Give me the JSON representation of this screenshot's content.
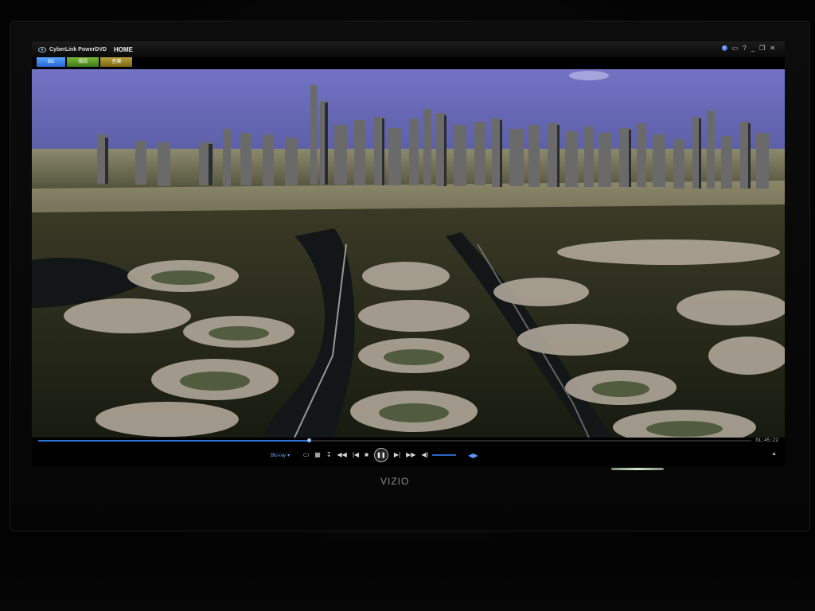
{
  "window": {
    "app_name": "CyberLink PowerDVD",
    "home_label": "HOME",
    "help_glyph": "?",
    "minimize_glyph": "_",
    "restore_glyph": "❐",
    "close_glyph": "✕"
  },
  "tabs": [
    {
      "label": "BD",
      "color": "#2f73d8"
    },
    {
      "label": "視訊",
      "color": "#4c8a1f"
    },
    {
      "label": "音樂",
      "color": "#8a721a"
    }
  ],
  "playback": {
    "progress": 0.38,
    "timecode": "01:45:22",
    "disc_label": "Blu-ray ▾"
  },
  "controls": {
    "menu_icon": "▭",
    "chapters_icon": "▦",
    "subtitles_icon": "↧",
    "rewind_icon": "◀◀",
    "prev_icon": "|◀",
    "stop_icon": "■",
    "pause_icon": "❚❚",
    "next_icon": "▶|",
    "forward_icon": "▶▶",
    "volume_icon": "◀)",
    "more_icon": "◀▶"
  },
  "tv": {
    "brand": "VIZIO"
  },
  "colors": {
    "accent": "#2c77d6",
    "sky": "#6e6fb8"
  }
}
